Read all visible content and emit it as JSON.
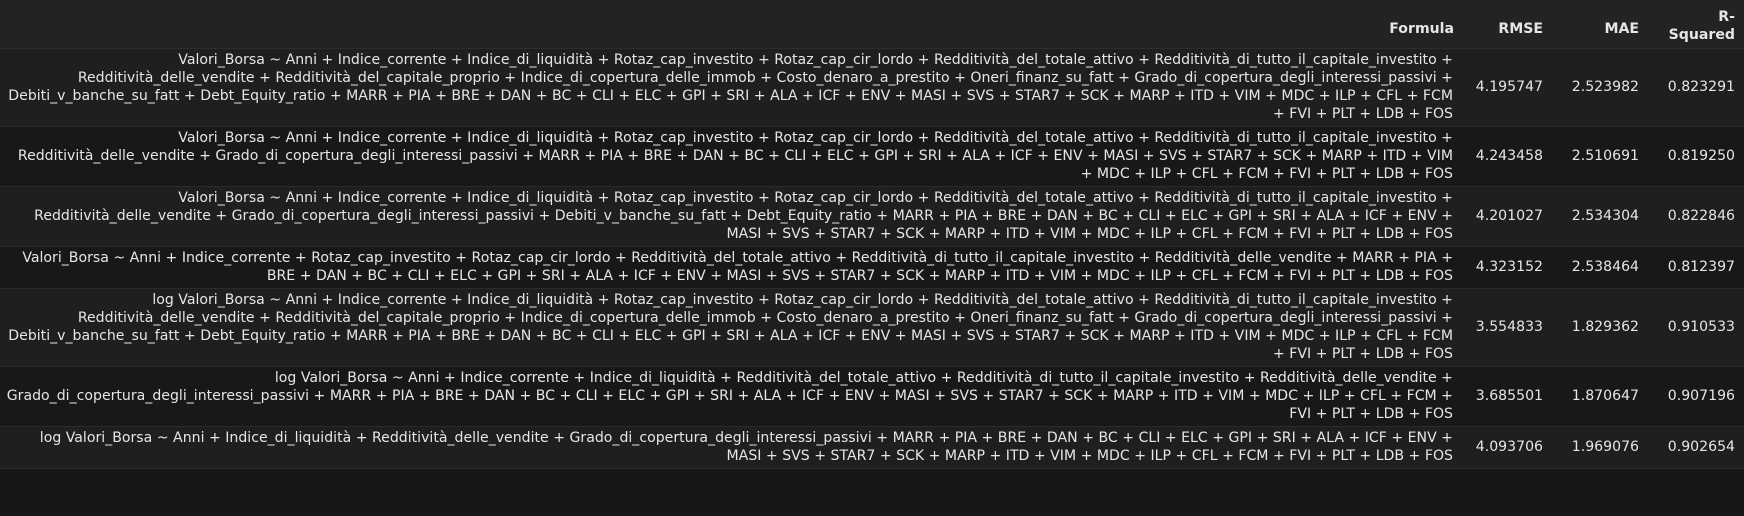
{
  "headers": {
    "formula": "Formula",
    "rmse": "RMSE",
    "mae": "MAE",
    "rsquared": "R-\nSquared",
    "rsquared_line1": "R-",
    "rsquared_line2": "Squared"
  },
  "rows": [
    {
      "formula": "Valori_Borsa ~ Anni + Indice_corrente + Indice_di_liquidità + Rotaz_cap_investito + Rotaz_cap_cir_lordo + Redditività_del_totale_attivo + Redditività_di_tutto_il_capitale_investito + Redditività_delle_vendite + Redditività_del_capitale_proprio + Indice_di_copertura_delle_immob + Costo_denaro_a_prestito + Oneri_finanz_su_fatt + Grado_di_copertura_degli_interessi_passivi + Debiti_v_banche_su_fatt + Debt_Equity_ratio + MARR + PIA + BRE + DAN + BC + CLI + ELC + GPI + SRI + ALA + ICF + ENV + MASI + SVS + STAR7 + SCK + MARP + ITD + VIM + MDC + ILP + CFL + FCM + FVI + PLT + LDB + FOS",
      "rmse": "4.195747",
      "mae": "2.523982",
      "rsquared": "0.823291"
    },
    {
      "formula": "Valori_Borsa ~ Anni + Indice_corrente + Indice_di_liquidità + Rotaz_cap_investito + Rotaz_cap_cir_lordo + Redditività_del_totale_attivo + Redditività_di_tutto_il_capitale_investito + Redditività_delle_vendite + Grado_di_copertura_degli_interessi_passivi + MARR + PIA + BRE + DAN + BC + CLI + ELC + GPI + SRI + ALA + ICF + ENV + MASI + SVS + STAR7 + SCK + MARP + ITD + VIM + MDC + ILP + CFL + FCM + FVI + PLT + LDB + FOS",
      "rmse": "4.243458",
      "mae": "2.510691",
      "rsquared": "0.819250"
    },
    {
      "formula": "Valori_Borsa ~ Anni + Indice_corrente + Indice_di_liquidità + Rotaz_cap_investito + Rotaz_cap_cir_lordo + Redditività_del_totale_attivo + Redditività_di_tutto_il_capitale_investito + Redditività_delle_vendite + Grado_di_copertura_degli_interessi_passivi + Debiti_v_banche_su_fatt + Debt_Equity_ratio + MARR + PIA + BRE + DAN + BC + CLI + ELC + GPI + SRI + ALA + ICF + ENV + MASI + SVS + STAR7 + SCK + MARP + ITD + VIM + MDC + ILP + CFL + FCM + FVI + PLT + LDB + FOS",
      "rmse": "4.201027",
      "mae": "2.534304",
      "rsquared": "0.822846"
    },
    {
      "formula": "Valori_Borsa ~ Anni + Indice_corrente + Rotaz_cap_investito + Rotaz_cap_cir_lordo + Redditività_del_totale_attivo + Redditività_di_tutto_il_capitale_investito + Redditività_delle_vendite + MARR + PIA + BRE + DAN + BC + CLI + ELC + GPI + SRI + ALA + ICF + ENV + MASI + SVS + STAR7 + SCK + MARP + ITD + VIM + MDC + ILP + CFL + FCM + FVI + PLT + LDB + FOS",
      "rmse": "4.323152",
      "mae": "2.538464",
      "rsquared": "0.812397"
    },
    {
      "formula": "log Valori_Borsa ~ Anni + Indice_corrente + Indice_di_liquidità + Rotaz_cap_investito + Rotaz_cap_cir_lordo + Redditività_del_totale_attivo + Redditività_di_tutto_il_capitale_investito + Redditività_delle_vendite + Redditività_del_capitale_proprio + Indice_di_copertura_delle_immob + Costo_denaro_a_prestito + Oneri_finanz_su_fatt + Grado_di_copertura_degli_interessi_passivi + Debiti_v_banche_su_fatt + Debt_Equity_ratio + MARR + PIA + BRE + DAN + BC + CLI + ELC + GPI + SRI + ALA + ICF + ENV + MASI + SVS + STAR7 + SCK + MARP + ITD + VIM + MDC + ILP + CFL + FCM + FVI + PLT + LDB + FOS",
      "rmse": "3.554833",
      "mae": "1.829362",
      "rsquared": "0.910533"
    },
    {
      "formula": "log Valori_Borsa ~ Anni + Indice_corrente + Indice_di_liquidità + Redditività_del_totale_attivo + Redditività_di_tutto_il_capitale_investito + Redditività_delle_vendite + Grado_di_copertura_degli_interessi_passivi + MARR + PIA + BRE + DAN + BC + CLI + ELC + GPI + SRI + ALA + ICF + ENV + MASI + SVS + STAR7 + SCK + MARP + ITD + VIM + MDC + ILP + CFL + FCM + FVI + PLT + LDB + FOS",
      "rmse": "3.685501",
      "mae": "1.870647",
      "rsquared": "0.907196"
    },
    {
      "formula": "log Valori_Borsa ~ Anni + Indice_di_liquidità + Redditività_delle_vendite + Grado_di_copertura_degli_interessi_passivi + MARR + PIA + BRE + DAN + BC + CLI + ELC + GPI + SRI + ALA + ICF + ENV + MASI + SVS + STAR7 + SCK + MARP + ITD + VIM + MDC + ILP + CFL + FCM + FVI + PLT + LDB + FOS",
      "rmse": "4.093706",
      "mae": "1.969076",
      "rsquared": "0.902654"
    }
  ]
}
